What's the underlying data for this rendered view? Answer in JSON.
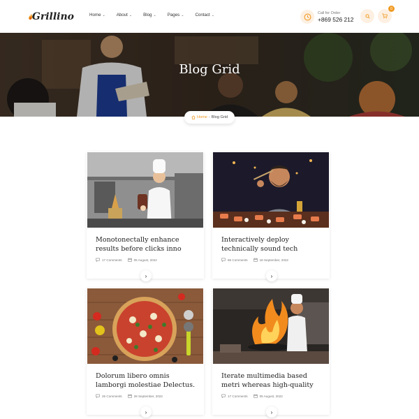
{
  "brand": {
    "name": "Grillino"
  },
  "nav": [
    {
      "label": "Home",
      "chevron": "⌄"
    },
    {
      "label": "About",
      "chevron": "⌄"
    },
    {
      "label": "Blog",
      "chevron": "⌄"
    },
    {
      "label": "Pages",
      "chevron": "⌄"
    },
    {
      "label": "Contact",
      "chevron": "⌄"
    }
  ],
  "call": {
    "label": "Call for Order",
    "phone": "+869 526 212"
  },
  "cart": {
    "count": "0"
  },
  "banner": {
    "title": "Blog Grid"
  },
  "breadcrumb": {
    "home": "Home",
    "separator": "›",
    "current": "Blog Grid"
  },
  "colors": {
    "accent": "#f09a22",
    "accent_light": "#fdf0e2"
  },
  "posts": [
    {
      "title": "Monotonectally enhance results before clicks inno",
      "comments": "17 Comments",
      "date": "05 August, 2022",
      "image": "chef-kitchen-photo"
    },
    {
      "title": "Interactively deploy technically sound tech",
      "comments": "86 Comments",
      "date": "18 September, 2022",
      "image": "man-eating-sushi-photo"
    },
    {
      "title": "Dolorum libero omnis lamborgi molestiae Delectus.",
      "comments": "26 Comments",
      "date": "28 September, 2022",
      "image": "pizza-photo"
    },
    {
      "title": "Iterate multimedia based metri whereas high-quality",
      "comments": "17 Comments",
      "date": "05 August, 2022",
      "image": "flambe-chef-photo"
    }
  ]
}
